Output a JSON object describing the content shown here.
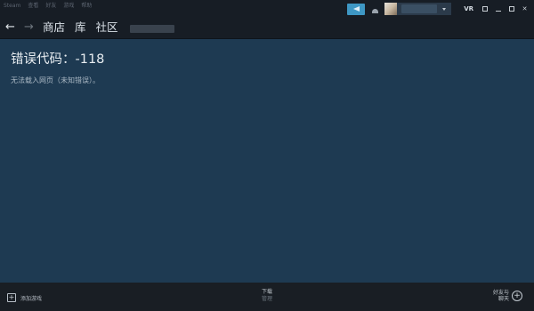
{
  "menu": {
    "items": [
      "Steam",
      "查看",
      "好友",
      "游戏",
      "帮助"
    ]
  },
  "titlebar": {
    "vr_label": "VR"
  },
  "nav": {
    "back": "←",
    "forward": "→",
    "links": [
      "商店",
      "库",
      "社区"
    ]
  },
  "error": {
    "title": "错误代码：-118",
    "message": "无法载入网页（未知错误）。"
  },
  "bottom": {
    "add_game": "添加游戏",
    "downloads_line1": "下载",
    "downloads_line2": "管理",
    "friends_line1": "好友与",
    "friends_line2": "聊天"
  },
  "colors": {
    "content_bg": "#1e3a52",
    "bar_bg": "#171d25",
    "accent": "#3e97c4"
  }
}
